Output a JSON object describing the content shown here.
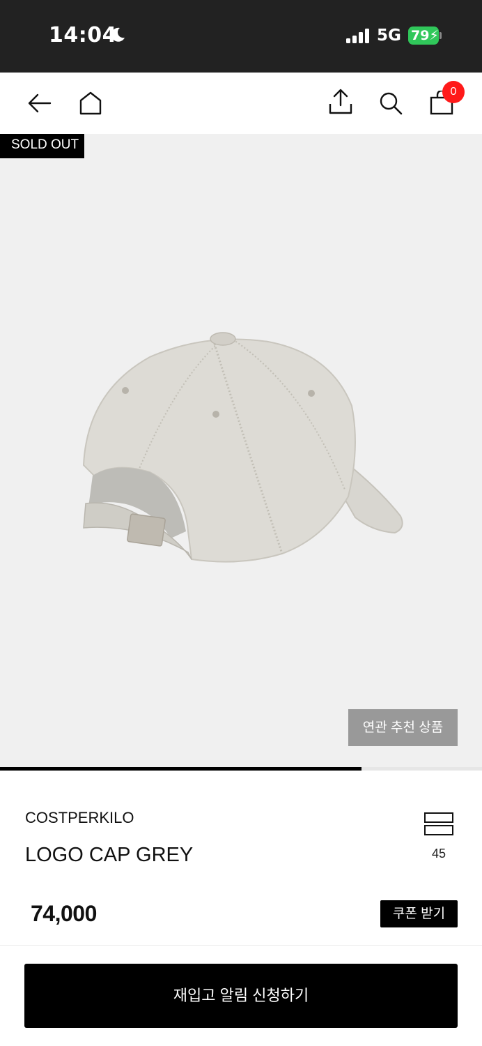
{
  "status_bar": {
    "time": "14:04",
    "network": "5G",
    "battery": "79"
  },
  "header": {
    "icons": [
      "back-arrow-icon",
      "home-icon",
      "share-icon",
      "search-icon",
      "cart-icon"
    ],
    "cart_count": "0"
  },
  "gallery": {
    "badge": "SOLD OUT",
    "related_button": "연관 추천 상품",
    "progress_fraction": 0.75
  },
  "product": {
    "brand": "COSTPERKILO",
    "name": "LOGO CAP GREY",
    "wish_count": "45",
    "price": "74,000",
    "coupon_button": "쿠폰 받기"
  },
  "footer": {
    "restock_button": "재입고 알림 신청하기"
  },
  "colors": {
    "status_bar_bg": "#222222",
    "battery": "#30c75a",
    "cart_badge": "#ff1a1a",
    "gallery_bg": "#f0f0f0",
    "related_button_bg": "#999999",
    "primary_button_bg": "#000000"
  }
}
